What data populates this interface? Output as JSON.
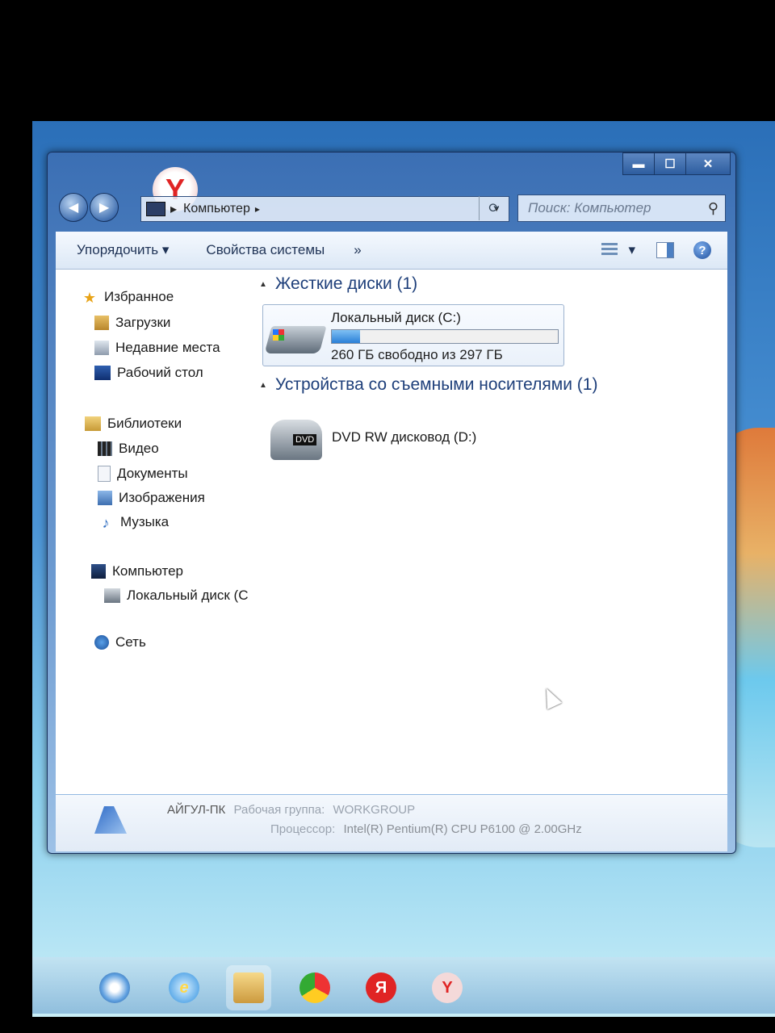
{
  "window": {
    "caption": {
      "minimize": "▬",
      "maximize": "☐",
      "close": "✕"
    },
    "nav": {
      "back": "◀",
      "forward": "▶"
    },
    "address": {
      "path": "Компьютер",
      "separator": "▸",
      "dropdown": "▼",
      "refresh": "⟳"
    },
    "search": {
      "placeholder": "Поиск: Компьютер",
      "icon": "search-icon"
    },
    "toolbar": {
      "organize": "Упорядочить ▾",
      "system_properties": "Свойства системы",
      "more": "»",
      "views_dropdown": "▾",
      "help": "?"
    }
  },
  "navpane": {
    "favorites": {
      "label": "Избранное",
      "items": [
        "Загрузки",
        "Недавние места",
        "Рабочий стол"
      ]
    },
    "libraries": {
      "label": "Библиотеки",
      "items": [
        "Видео",
        "Документы",
        "Изображения",
        "Музыка"
      ]
    },
    "computer": {
      "label": "Компьютер",
      "items": [
        "Локальный диск (C"
      ]
    },
    "network": {
      "label": "Сеть"
    }
  },
  "main": {
    "hard_drives_header": "Жесткие диски (1)",
    "removable_header": "Устройства со съемными носителями (1)",
    "drive_c": {
      "name": "Локальный диск (C:)",
      "free_text": "260 ГБ свободно из 297 ГБ",
      "used_fraction": 0.125
    },
    "dvd": {
      "name": "DVD RW дисковод (D:)",
      "badge": "DVD"
    }
  },
  "details": {
    "computer_name": "АЙГУЛ-ПК",
    "workgroup_label": "Рабочая группа:",
    "workgroup_value": "WORKGROUP",
    "processor_label": "Процессор:",
    "processor_value": "Intel(R) Pentium(R) CPU        P6100  @ 2.00GHz"
  },
  "taskbar": {
    "yandex_badge": "Y",
    "yandex_browser": "Я",
    "yandex_y": "Y"
  },
  "colors": {
    "accent": "#2a7fd7",
    "window_frame": "#3b6fb4",
    "yandex_red": "#e02424"
  }
}
